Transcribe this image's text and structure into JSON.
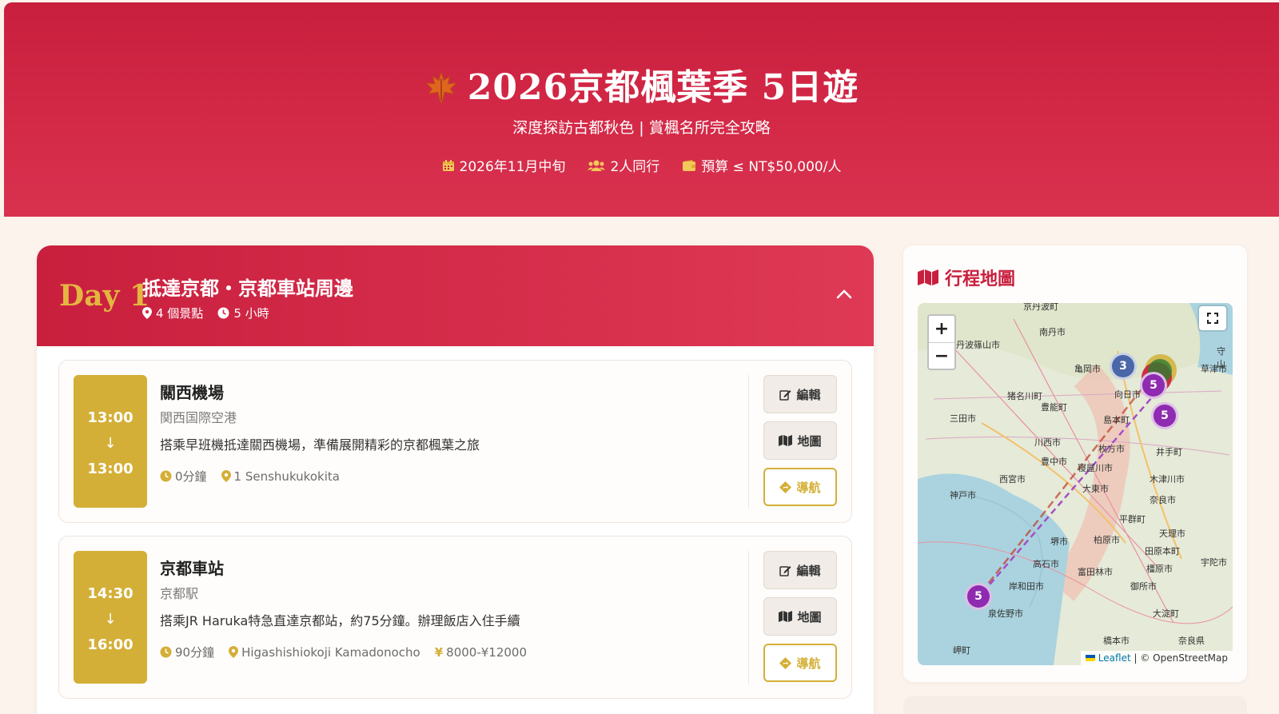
{
  "hero": {
    "title": "2026京都楓葉季 5日遊",
    "subtitle": "深度探訪古都秋色 | 賞楓名所完全攻略",
    "meta": {
      "date": "2026年11月中旬",
      "people": "2人同行",
      "budget": "預算 ≤ NT$50,000/人"
    }
  },
  "day": {
    "label": "Day 1",
    "title": "抵達京都・京都車站周邊",
    "spots_count": "4 個景點",
    "duration": "5 小時"
  },
  "spots": [
    {
      "start": "13:00",
      "end": "13:00",
      "arrow": "↓",
      "name": "關西機場",
      "jp_name": "関西国際空港",
      "desc": "搭乘早班機抵達關西機場，準備展開精彩的京都楓葉之旅",
      "stay": "0分鐘",
      "address": "1 Senshukukokita",
      "price": ""
    },
    {
      "start": "14:30",
      "end": "16:00",
      "arrow": "↓",
      "name": "京都車站",
      "jp_name": "京都駅",
      "desc": "搭乘JR Haruka特急直達京都站，約75分鐘。辦理飯店入住手續",
      "stay": "90分鐘",
      "address": "Higashishiokoji Kamadonocho",
      "price": "¥8000-¥12000"
    }
  ],
  "buttons": {
    "edit": "編輯",
    "map": "地圖",
    "navigate": "導航"
  },
  "map": {
    "title": "行程地圖",
    "zoom_in": "+",
    "zoom_out": "−",
    "attribution_leaflet": "Leaflet",
    "attribution_rest": "| © OpenStreetMap",
    "clusters": [
      "3",
      "5",
      "5",
      "5"
    ],
    "places": [
      "京丹波町",
      "南丹市",
      "丹波篠山市",
      "亀岡市",
      "守山",
      "草津市",
      "猪名川町",
      "豊能町",
      "向日市",
      "三田市",
      "島本町",
      "川西市",
      "井手町",
      "枚方市",
      "豊中市",
      "寝屋川市",
      "木津川市",
      "西宮市",
      "大東市",
      "神戸市",
      "奈良市",
      "平群町",
      "堺市",
      "柏原市",
      "天理市",
      "田原本町",
      "宇陀市",
      "高石市",
      "橿原市",
      "富田林市",
      "岸和田市",
      "御所市",
      "大淀町",
      "泉佐野市",
      "橋本市",
      "岬町",
      "奈良県"
    ],
    "colors": {
      "cluster_blue": "#4a67a8",
      "cluster_purple": "#8e2bb0",
      "route": "#c0392b"
    }
  },
  "colors": {
    "brand_red": "#c91f3e",
    "gold": "#d4af37",
    "background": "#fbf3ec"
  }
}
